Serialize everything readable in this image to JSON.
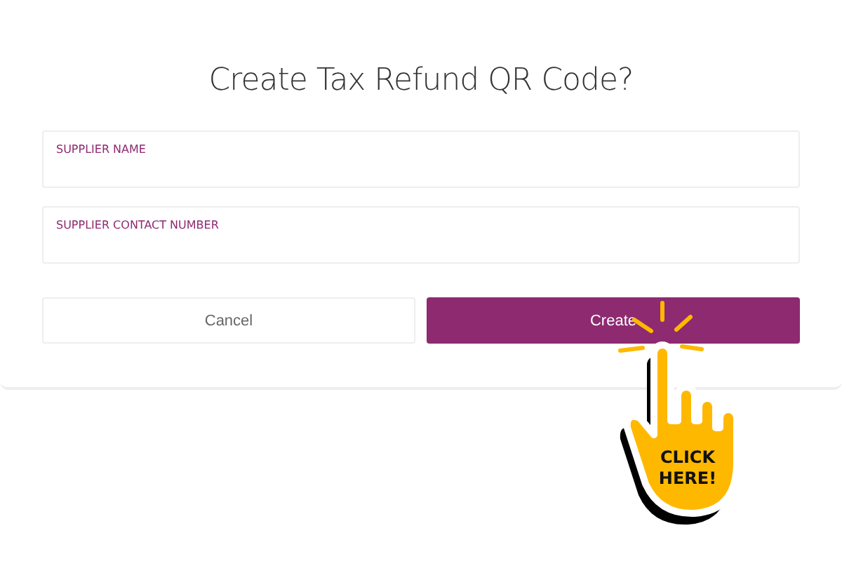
{
  "dialog": {
    "title": "Create Tax Refund QR Code?",
    "fields": [
      {
        "label": "SUPPLIER NAME"
      },
      {
        "label": "SUPPLIER CONTACT NUMBER"
      }
    ],
    "buttons": [
      {
        "label": "Cancel",
        "kind": "secondary"
      },
      {
        "label": "Create",
        "kind": "primary"
      }
    ]
  },
  "callout": {
    "text_lines": [
      "CLICK",
      "HERE!"
    ]
  }
}
